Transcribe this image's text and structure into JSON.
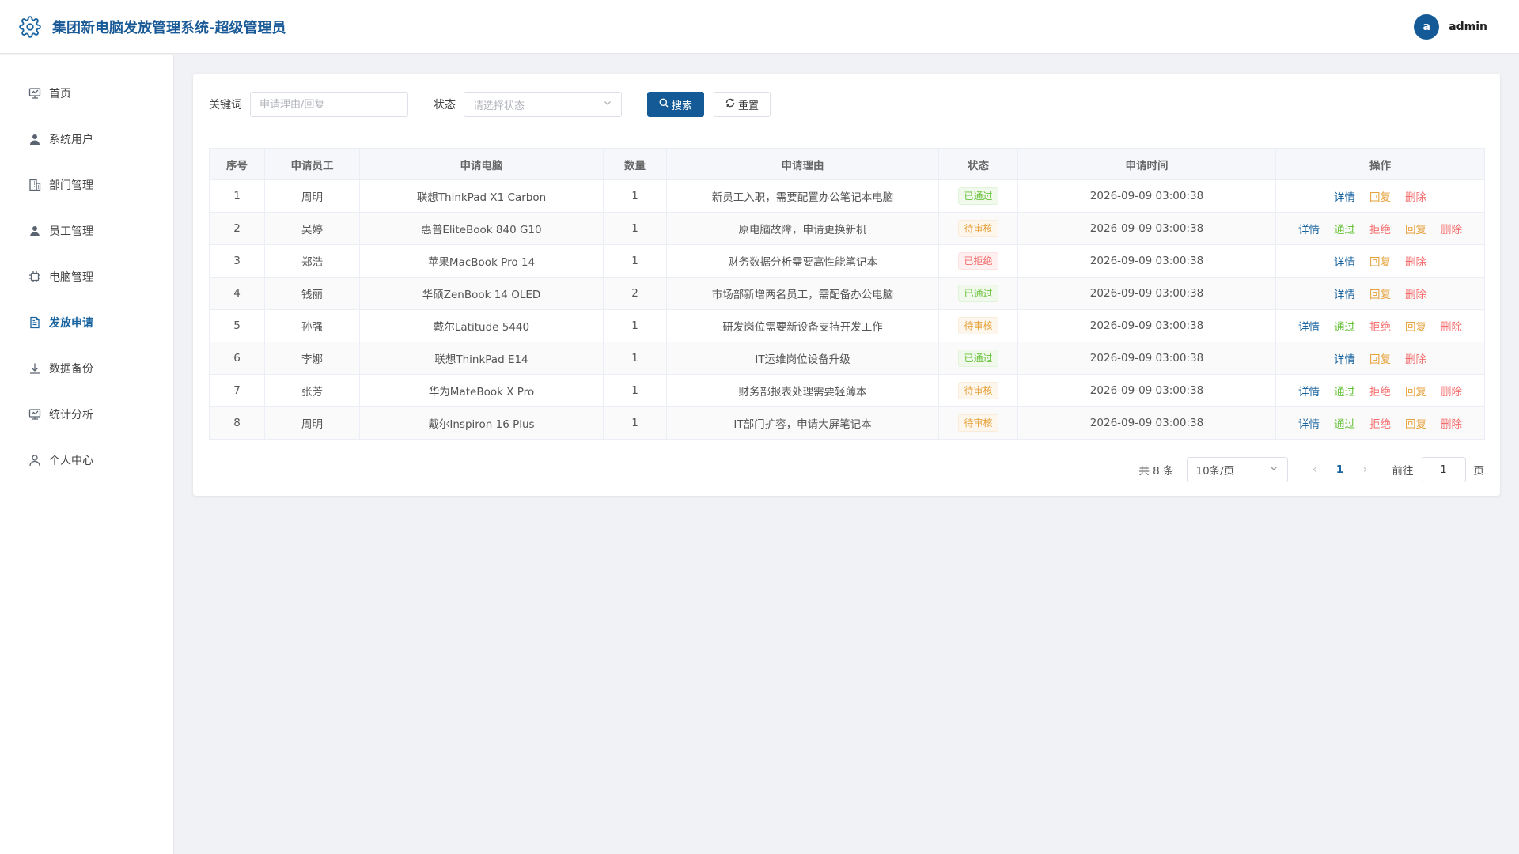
{
  "header": {
    "title": "集团新电脑发放管理系统-超级管理员",
    "avatar_letter": "a",
    "username": "admin"
  },
  "sidebar": {
    "items": [
      {
        "label": "首页",
        "icon": "dashboard-icon",
        "active": false
      },
      {
        "label": "系统用户",
        "icon": "user-icon",
        "active": false
      },
      {
        "label": "部门管理",
        "icon": "building-icon",
        "active": false
      },
      {
        "label": "员工管理",
        "icon": "user-icon",
        "active": false
      },
      {
        "label": "电脑管理",
        "icon": "cpu-icon",
        "active": false
      },
      {
        "label": "发放申请",
        "icon": "document-icon",
        "active": true
      },
      {
        "label": "数据备份",
        "icon": "download-icon",
        "active": false
      },
      {
        "label": "统计分析",
        "icon": "chart-icon",
        "active": false
      },
      {
        "label": "个人中心",
        "icon": "person-icon",
        "active": false
      }
    ]
  },
  "filters": {
    "keyword_label": "关键词",
    "keyword_placeholder": "申请理由/回复",
    "keyword_value": "",
    "status_label": "状态",
    "status_placeholder": "请选择状态",
    "search_label": "搜索",
    "reset_label": "重置"
  },
  "table": {
    "columns": [
      "序号",
      "申请员工",
      "申请电脑",
      "数量",
      "申请理由",
      "状态",
      "申请时间",
      "操作"
    ],
    "rows": [
      {
        "no": "1",
        "employee": "周明",
        "computer": "联想ThinkPad X1 Carbon",
        "qty": "1",
        "reason": "新员工入职，需要配置办公笔记本电脑",
        "status": "已通过",
        "status_type": "ok",
        "time": "2026-09-09 03:00:38",
        "actions": [
          "详情",
          "回复",
          "删除"
        ]
      },
      {
        "no": "2",
        "employee": "吴婷",
        "computer": "惠普EliteBook 840 G10",
        "qty": "1",
        "reason": "原电脑故障，申请更换新机",
        "status": "待审核",
        "status_type": "pend",
        "time": "2026-09-09 03:00:38",
        "actions": [
          "详情",
          "通过",
          "拒绝",
          "回复",
          "删除"
        ]
      },
      {
        "no": "3",
        "employee": "郑浩",
        "computer": "苹果MacBook Pro 14",
        "qty": "1",
        "reason": "财务数据分析需要高性能笔记本",
        "status": "已拒绝",
        "status_type": "rej",
        "time": "2026-09-09 03:00:38",
        "actions": [
          "详情",
          "回复",
          "删除"
        ]
      },
      {
        "no": "4",
        "employee": "钱丽",
        "computer": "华硕ZenBook 14 OLED",
        "qty": "2",
        "reason": "市场部新增两名员工，需配备办公电脑",
        "status": "已通过",
        "status_type": "ok",
        "time": "2026-09-09 03:00:38",
        "actions": [
          "详情",
          "回复",
          "删除"
        ]
      },
      {
        "no": "5",
        "employee": "孙强",
        "computer": "戴尔Latitude 5440",
        "qty": "1",
        "reason": "研发岗位需要新设备支持开发工作",
        "status": "待审核",
        "status_type": "pend",
        "time": "2026-09-09 03:00:38",
        "actions": [
          "详情",
          "通过",
          "拒绝",
          "回复",
          "删除"
        ]
      },
      {
        "no": "6",
        "employee": "李娜",
        "computer": "联想ThinkPad E14",
        "qty": "1",
        "reason": "IT运维岗位设备升级",
        "status": "已通过",
        "status_type": "ok",
        "time": "2026-09-09 03:00:38",
        "actions": [
          "详情",
          "回复",
          "删除"
        ]
      },
      {
        "no": "7",
        "employee": "张芳",
        "computer": "华为MateBook X Pro",
        "qty": "1",
        "reason": "财务部报表处理需要轻薄本",
        "status": "待审核",
        "status_type": "pend",
        "time": "2026-09-09 03:00:38",
        "actions": [
          "详情",
          "通过",
          "拒绝",
          "回复",
          "删除"
        ]
      },
      {
        "no": "8",
        "employee": "周明",
        "computer": "戴尔Inspiron 16 Plus",
        "qty": "1",
        "reason": "IT部门扩容，申请大屏笔记本",
        "status": "待审核",
        "status_type": "pend",
        "time": "2026-09-09 03:00:38",
        "actions": [
          "详情",
          "通过",
          "拒绝",
          "回复",
          "删除"
        ]
      }
    ]
  },
  "pagination": {
    "total_text": "共 8 条",
    "page_size": "10条/页",
    "current_page": "1",
    "goto_label": "前往",
    "goto_value": "1",
    "page_unit": "页"
  },
  "colors": {
    "primary": "#135a96",
    "success": "#67c23a",
    "warning": "#e6a23c",
    "danger": "#f56c6c"
  }
}
